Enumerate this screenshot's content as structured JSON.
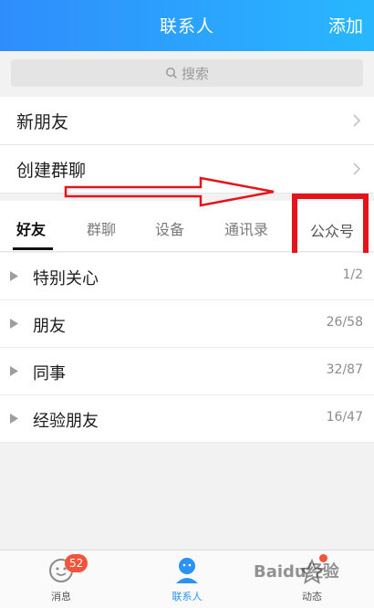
{
  "header": {
    "title": "联系人",
    "add_label": "添加"
  },
  "search": {
    "placeholder": "搜索"
  },
  "menu": [
    {
      "label": "新朋友"
    },
    {
      "label": "创建群聊"
    }
  ],
  "tabs": [
    {
      "label": "好友",
      "active": true
    },
    {
      "label": "群聊"
    },
    {
      "label": "设备"
    },
    {
      "label": "通讯录"
    },
    {
      "label": "公众号"
    }
  ],
  "groups": [
    {
      "name": "特别关心",
      "count": "1/2"
    },
    {
      "name": "朋友",
      "count": "26/58"
    },
    {
      "name": "同事",
      "count": "32/87"
    },
    {
      "name": "经验朋友",
      "count": "16/47"
    }
  ],
  "bottom": {
    "items": [
      {
        "label": "消息",
        "badge": "52"
      },
      {
        "label": "联系人"
      },
      {
        "label": "动态"
      }
    ]
  },
  "watermark": "Baidu经验",
  "colors": {
    "accent": "#2a93f5",
    "annotation_red": "#e5141b",
    "badge": "#f2533a"
  }
}
